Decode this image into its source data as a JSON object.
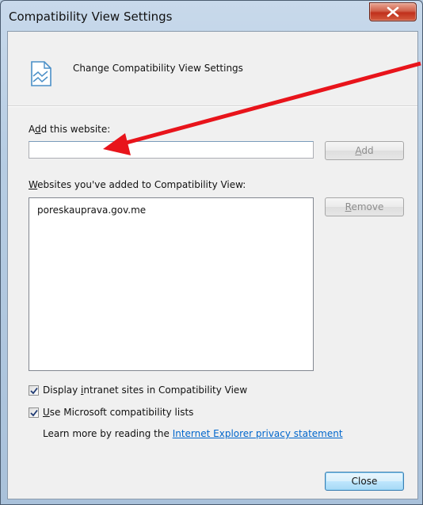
{
  "window": {
    "title": "Compatibility View Settings",
    "close_label": "x"
  },
  "header": {
    "icon": "compatibility-page-icon",
    "text": "Change Compatibility View Settings"
  },
  "add_site": {
    "label_prefix": "A",
    "label_accel": "d",
    "label_rest": "d this website:",
    "value": "",
    "button_accel": "A",
    "button_rest": "dd"
  },
  "sites": {
    "label_accel": "W",
    "label_rest": "ebsites you've added to Compatibility View:",
    "items": [
      "poreskauprava.gov.me"
    ],
    "remove_accel": "R",
    "remove_rest": "emove"
  },
  "options": {
    "intranet_prefix": "Display ",
    "intranet_accel": "i",
    "intranet_rest": "ntranet sites in Compatibility View",
    "intranet_checked": true,
    "mscompat_accel": "U",
    "mscompat_rest": "se Microsoft compatibility lists",
    "mscompat_checked": true
  },
  "learn_more": {
    "text": "Learn more by reading the ",
    "link": "Internet Explorer privacy statement"
  },
  "footer": {
    "close_label": "Close"
  },
  "colors": {
    "annotation_arrow": "#e8141b",
    "link": "#0066cc"
  }
}
